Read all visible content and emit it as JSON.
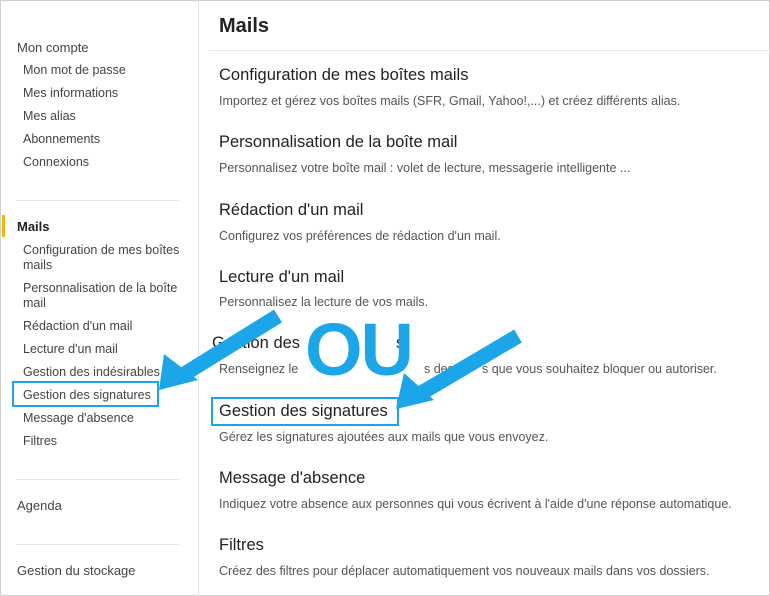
{
  "sidebar": {
    "account": {
      "heading": "Mon compte",
      "items": [
        "Mon mot de passe",
        "Mes informations",
        "Mes alias",
        "Abonnements",
        "Connexions"
      ]
    },
    "mails": {
      "heading": "Mails",
      "items": [
        "Configuration de mes boîtes mails",
        "Personnalisation de la boîte mail",
        "Rédaction d'un mail",
        "Lecture d'un mail",
        "Gestion des indésirables",
        "Gestion des signatures",
        "Message d'absence",
        "Filtres"
      ]
    },
    "agenda": "Agenda",
    "storage": "Gestion du stockage"
  },
  "main": {
    "title": "Mails",
    "sections": [
      {
        "title": "Configuration de mes boîtes mails",
        "desc": "Importez et gérez vos boîtes mails (SFR, Gmail, Yahoo!,...) et créez différents alias."
      },
      {
        "title": "Personnalisation de la boîte mail",
        "desc": "Personnalisez votre boîte mail : volet de lecture, messagerie intelligente ..."
      },
      {
        "title": "Rédaction d'un mail",
        "desc": "Configurez vos préférences de rédaction d'un mail."
      },
      {
        "title": "Lecture d'un mail",
        "desc": "Personnalisez la lecture de vos mails."
      },
      {
        "title": "Gestion des",
        "desc": "Renseignez le",
        "title_end": "s",
        "desc_mid": "s des",
        "desc_end": "s que vous souhaitez bloquer ou autoriser."
      },
      {
        "title": "Gestion des signatures",
        "desc": "Gérez les signatures ajoutées aux mails que vous envoyez."
      },
      {
        "title": "Message d'absence",
        "desc": "Indiquez votre absence aux personnes qui vous écrivent à l'aide d'une réponse automatique."
      },
      {
        "title": "Filtres",
        "desc": "Créez des filtres pour déplacer automatiquement vos nouveaux mails dans vos dossiers."
      }
    ]
  },
  "overlay": {
    "text": "OU"
  },
  "colors": {
    "highlight": "#1aa6e8",
    "active_bar": "#f5b400"
  }
}
